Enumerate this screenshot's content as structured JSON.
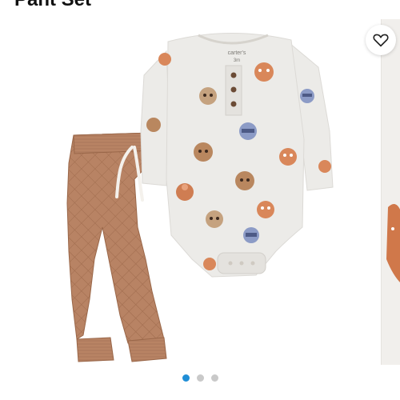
{
  "product": {
    "title": "Pant Set"
  },
  "gallery": {
    "image_count": 3,
    "active_index": 0,
    "accent_color": "#1f8ed6",
    "inactive_color": "#c9c9c9"
  },
  "bodysuit": {
    "label_line1": "carter's",
    "label_line2": "3m",
    "color": "#ecebe8"
  },
  "pants": {
    "color": "#b88364"
  },
  "favorite": {
    "icon": "heart-icon"
  }
}
